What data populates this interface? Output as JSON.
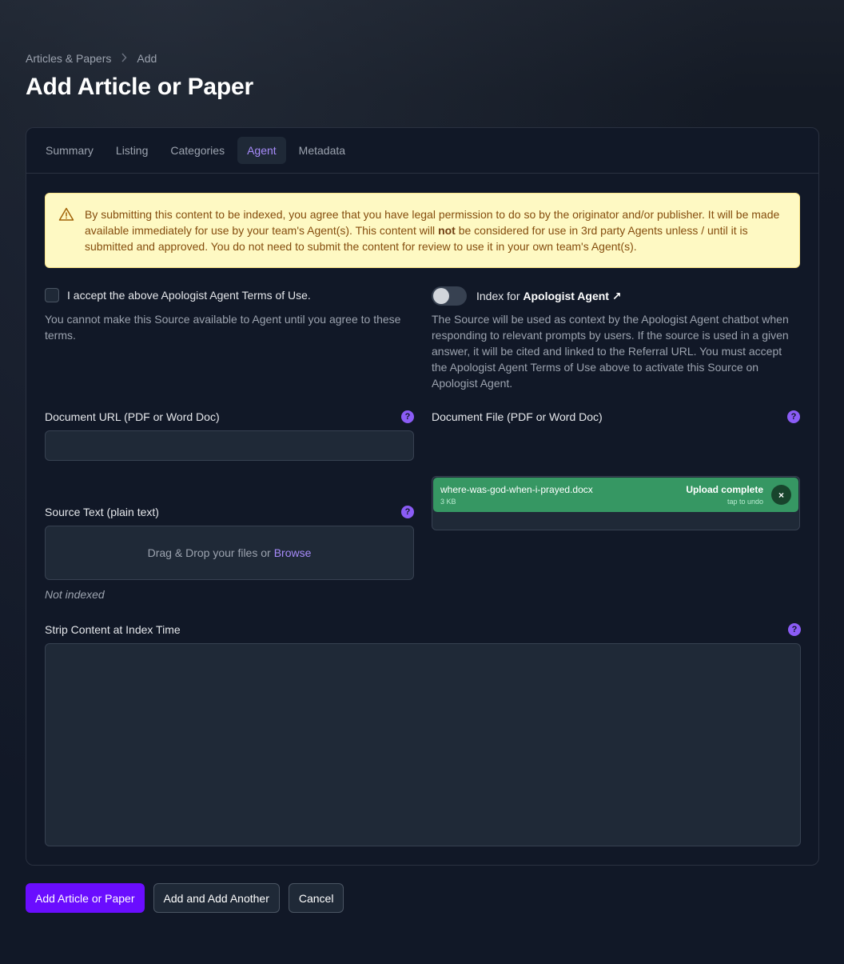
{
  "breadcrumb": {
    "parent": "Articles & Papers",
    "current": "Add"
  },
  "page_title": "Add Article or Paper",
  "tabs": [
    {
      "label": "Summary",
      "active": false
    },
    {
      "label": "Listing",
      "active": false
    },
    {
      "label": "Categories",
      "active": false
    },
    {
      "label": "Agent",
      "active": true
    },
    {
      "label": "Metadata",
      "active": false
    }
  ],
  "warning": {
    "text_1": "By submitting this content to be indexed, you agree that you have legal permission to do so by the originator and/or publisher. It will be made available immediately for use by your team's Agent(s). This content will ",
    "bold": "not",
    "text_2": " be considered for use in 3rd party Agents unless / until it is submitted and approved. You do not need to submit the content for review to use it in your own team's Agent(s)."
  },
  "terms": {
    "label": "I accept the above Apologist Agent Terms of Use.",
    "helper": "You cannot make this Source available to Agent until you agree to these terms.",
    "checked": false
  },
  "index_toggle": {
    "label_prefix": "Index for ",
    "label_bold": "Apologist Agent",
    "link_icon": "↗",
    "on": false,
    "helper": "The Source will be used as context by the Apologist Agent chatbot when responding to relevant prompts by users. If the source is used in a given answer, it will be cited and linked to the Referral URL. You must accept the Apologist Agent Terms of Use above to activate this Source on Apologist Agent."
  },
  "document_url": {
    "label": "Document URL (PDF or Word Doc)",
    "value": "",
    "help": "?"
  },
  "document_file": {
    "label": "Document File (PDF or Word Doc)",
    "help": "?",
    "file_name": "where-was-god-when-i-prayed.docx",
    "file_size": "3 KB",
    "status": "Upload complete",
    "undo": "tap to undo",
    "remove": "×"
  },
  "source_text": {
    "label": "Source Text (plain text)",
    "help": "?",
    "drop_text": "Drag & Drop your files or",
    "browse": "Browse",
    "status": "Not indexed"
  },
  "strip_content": {
    "label": "Strip Content at Index Time",
    "help": "?",
    "value": ""
  },
  "actions": {
    "primary": "Add Article or Paper",
    "add_another": "Add and Add Another",
    "cancel": "Cancel"
  },
  "colors": {
    "accent": "#a78bfa",
    "primary_button": "#6a0dff",
    "upload_success": "#369763",
    "warning_bg": "#fef9c3"
  }
}
